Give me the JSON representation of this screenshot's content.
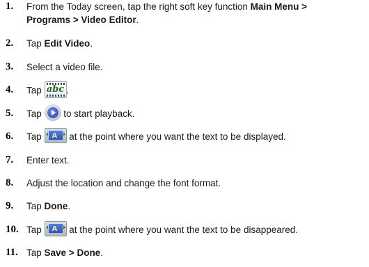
{
  "steps": [
    {
      "number": "1.",
      "line1_text": "From the Today screen, tap the right soft key function ",
      "line1_bold": "Main Menu >",
      "line2_bold": "Programs > Video Editor",
      "line2_end": "."
    },
    {
      "number": "2.",
      "pre": "Tap ",
      "bold": "Edit Video",
      "post": "."
    },
    {
      "number": "3.",
      "text": "Select a video file."
    },
    {
      "number": "4.",
      "pre": "Tap ",
      "icon": "abc-text-icon",
      "icon_text": "abc",
      "post": "."
    },
    {
      "number": "5.",
      "pre": "Tap ",
      "icon": "play-icon",
      "post": " to start playback."
    },
    {
      "number": "6.",
      "pre": "Tap ",
      "icon": "text-start-icon",
      "post": " at the point where you want the text to be displayed."
    },
    {
      "number": "7.",
      "text": "Enter text."
    },
    {
      "number": "8.",
      "text": "Adjust the location and change the font format."
    },
    {
      "number": "9.",
      "pre": "Tap ",
      "bold": "Done",
      "post": "."
    },
    {
      "number": "10.",
      "pre": "Tap ",
      "icon": "text-end-icon",
      "post": " at the point where you want the text to be disappeared."
    },
    {
      "number": "11.",
      "pre": "Tap ",
      "bold": "Save > Done",
      "post": "."
    }
  ],
  "icons": {
    "film_text_glyph": "A"
  }
}
